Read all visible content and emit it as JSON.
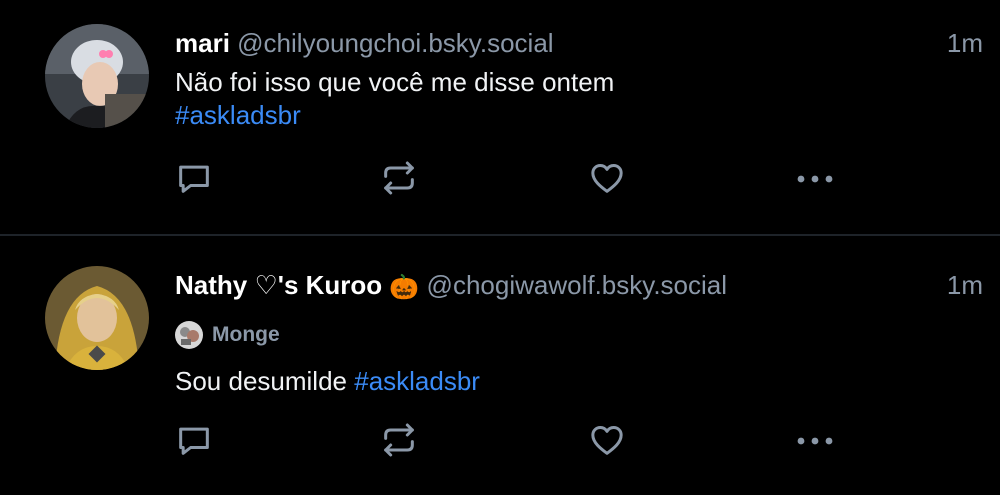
{
  "theme": {
    "background": "#000000",
    "text": "#ffffff",
    "muted": "#8b98a8",
    "link": "#3b8bf6",
    "divider": "#1e2329"
  },
  "posts": [
    {
      "display_name": "mari",
      "handle": "@chilyoungchoi.bsky.social",
      "time": "1m",
      "text": "Não foi isso que você me disse ontem",
      "hashtag": "#askladsbr",
      "actions": [
        "reply-icon",
        "repost-icon",
        "like-icon",
        "more-icon"
      ]
    },
    {
      "display_name": "Nathy ♡'s Kuroo",
      "display_name_emoji": "🎃",
      "handle": "@chogiwawolf.bsky.social",
      "time": "1m",
      "label": "Monge",
      "text": "Sou desumilde",
      "hashtag": "#askladsbr",
      "actions": [
        "reply-icon",
        "repost-icon",
        "like-icon",
        "more-icon"
      ]
    }
  ]
}
